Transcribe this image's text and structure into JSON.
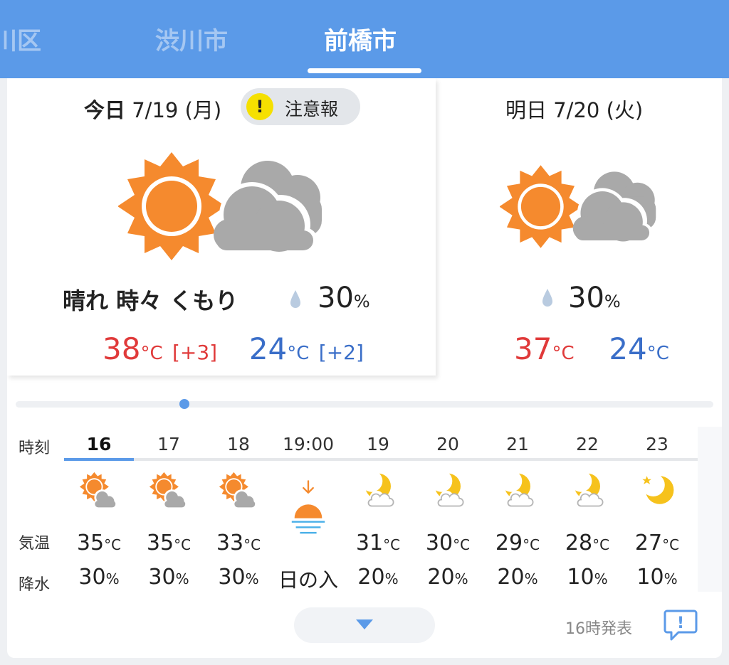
{
  "tabs": [
    {
      "label": "川区"
    },
    {
      "label": "渋川市"
    },
    {
      "label": "前橋市"
    }
  ],
  "today": {
    "date_label": "今日",
    "date": "7/19",
    "weekday": "(月)",
    "warning": "注意報",
    "warning_icon": "!",
    "weather_icon": "sun-with-cloud-icon",
    "condition": "晴れ 時々 くもり",
    "pop_value": "30",
    "pop_unit": "%",
    "high": "38",
    "high_unit": "°C",
    "high_diff": "[+3]",
    "low": "24",
    "low_unit": "°C",
    "low_diff": "[+2]"
  },
  "tomorrow": {
    "date_label": "明日",
    "date": "7/20",
    "weekday": "(火)",
    "weather_icon": "sun-with-cloud-icon",
    "pop_value": "30",
    "pop_unit": "%",
    "high": "37",
    "high_unit": "°C",
    "low": "24",
    "low_unit": "°C"
  },
  "hourly": {
    "labels": {
      "time": "時刻",
      "temp": "気温",
      "rain": "降水"
    },
    "hours": [
      {
        "time": "16",
        "icon": "sun-cloud-icon",
        "temp": "35",
        "unit": "°C",
        "rain": "30",
        "rain_unit": "%"
      },
      {
        "time": "17",
        "icon": "sun-cloud-icon",
        "temp": "35",
        "unit": "°C",
        "rain": "30",
        "rain_unit": "%"
      },
      {
        "time": "18",
        "icon": "sun-cloud-icon",
        "temp": "33",
        "unit": "°C",
        "rain": "30",
        "rain_unit": "%"
      },
      {
        "time": "19:00",
        "icon": "sunset-icon",
        "temp": "",
        "unit": "",
        "rain": "日の入",
        "rain_unit": ""
      },
      {
        "time": "19",
        "icon": "moon-cloud-icon",
        "temp": "31",
        "unit": "°C",
        "rain": "20",
        "rain_unit": "%"
      },
      {
        "time": "20",
        "icon": "moon-cloud-icon",
        "temp": "30",
        "unit": "°C",
        "rain": "20",
        "rain_unit": "%"
      },
      {
        "time": "21",
        "icon": "moon-cloud-icon",
        "temp": "29",
        "unit": "°C",
        "rain": "20",
        "rain_unit": "%"
      },
      {
        "time": "22",
        "icon": "moon-cloud-icon",
        "temp": "28",
        "unit": "°C",
        "rain": "10",
        "rain_unit": "%"
      },
      {
        "time": "23",
        "icon": "moon-star-icon",
        "temp": "27",
        "unit": "°C",
        "rain": "10",
        "rain_unit": "%"
      }
    ]
  },
  "footer": {
    "issued": "16時発表",
    "feedback_icon": "!"
  },
  "colors": {
    "accent": "#5b9ae8",
    "high": "#e03a3a",
    "low": "#3a6ec8",
    "sun": "#f58a2e",
    "cloud": "#a9a9a9",
    "moon": "#f6c21c",
    "warning": "#f5e000"
  }
}
